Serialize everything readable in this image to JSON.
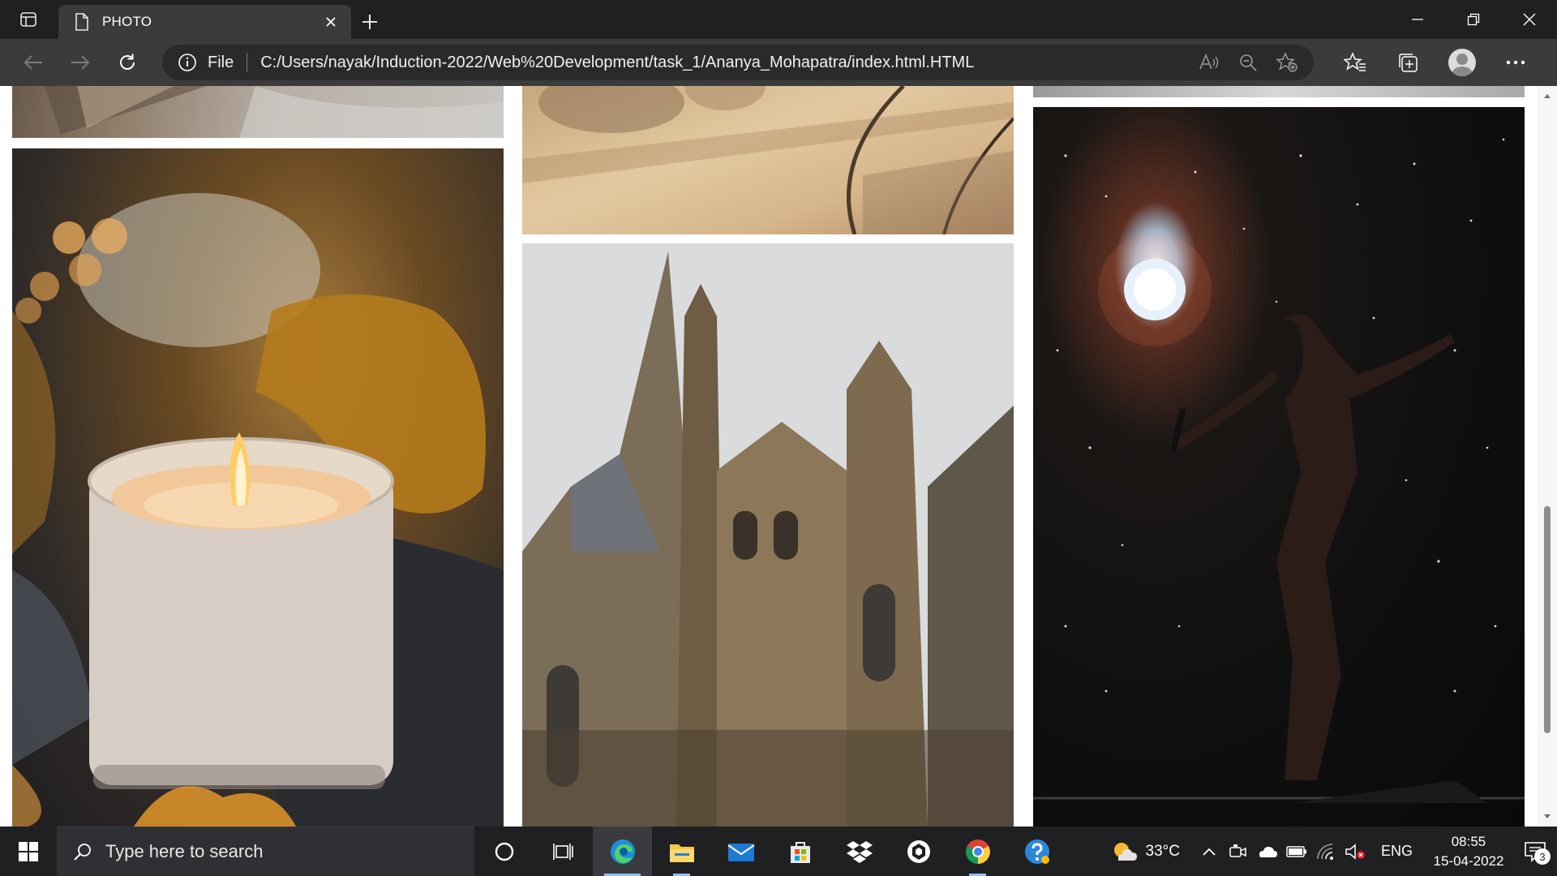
{
  "browser": {
    "tab": {
      "title": "PHOTO"
    },
    "address": {
      "scheme_label": "File",
      "url": "C:/Users/nayak/Induction-2022/Web%20Development/task_1/Ananya_Mohapatra/index.html.HTML"
    }
  },
  "page": {
    "images": [
      {
        "name": "bedding-photo"
      },
      {
        "name": "candle-photo"
      },
      {
        "name": "table-shadow-photo"
      },
      {
        "name": "gothic-cathedral-photo"
      },
      {
        "name": "snow-photo"
      },
      {
        "name": "singer-stage-photo"
      }
    ]
  },
  "taskbar": {
    "search_placeholder": "Type here to search",
    "weather": {
      "temperature": "33°C"
    },
    "language": "ENG",
    "clock": {
      "time": "08:55",
      "date": "15-04-2022"
    },
    "notification_count": "3"
  },
  "colors": {
    "titlebar": "#202020",
    "toolbar": "#3b3b3b",
    "taskbar": "#1f2022",
    "accent": "#8fc1f5"
  }
}
